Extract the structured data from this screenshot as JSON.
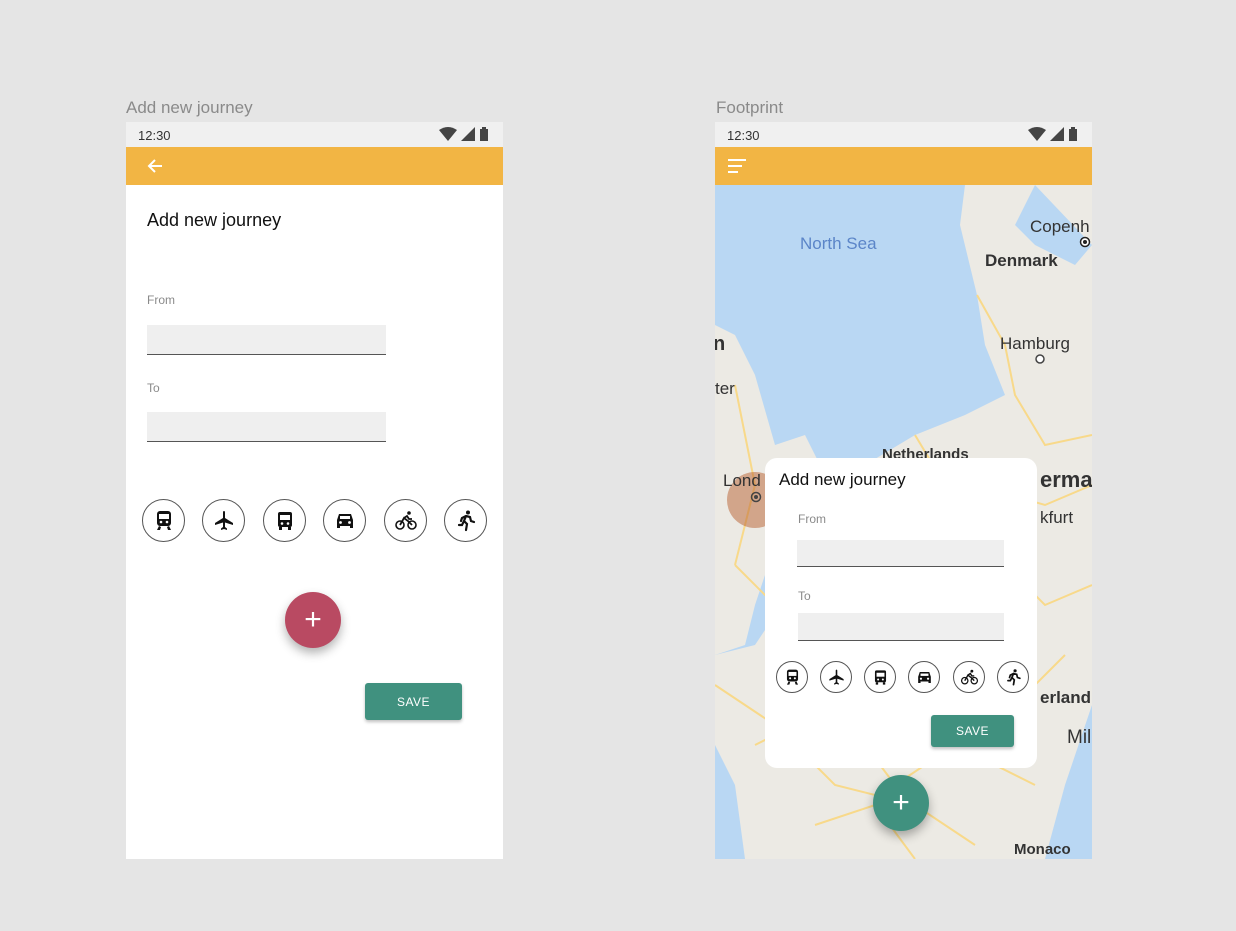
{
  "colors": {
    "toolbar": "#f2b544",
    "save": "#40917f",
    "fab_left": "#b94a62",
    "fab_right": "#40917f",
    "sea": "#b9d7f3",
    "land": "#eceae4",
    "road": "#f8d98a"
  },
  "screens": [
    {
      "frame_label": "Add new journey",
      "status_time": "12:30",
      "toolbar_icon": "back-arrow-icon",
      "title": "Add new journey",
      "from_label": "From",
      "from_value": "",
      "to_label": "To",
      "to_value": "",
      "modes": [
        "train",
        "plane",
        "bus",
        "car",
        "bike",
        "walk"
      ],
      "fab": "+",
      "save_label": "SAVE"
    },
    {
      "frame_label": "Footprint",
      "status_time": "12:30",
      "toolbar_icon": "menu-icon",
      "dialog": {
        "title": "Add new journey",
        "from_label": "From",
        "from_value": "",
        "to_label": "To",
        "to_value": "",
        "save_label": "SAVE"
      },
      "fab": "+",
      "map_labels": [
        "North Sea",
        "Copenh",
        "Denmark",
        "Hamburg",
        "Netherlands",
        "Lond",
        "erma",
        "kfurt",
        "erland",
        "Mil",
        "Monaco",
        "n",
        "ter"
      ]
    }
  ]
}
